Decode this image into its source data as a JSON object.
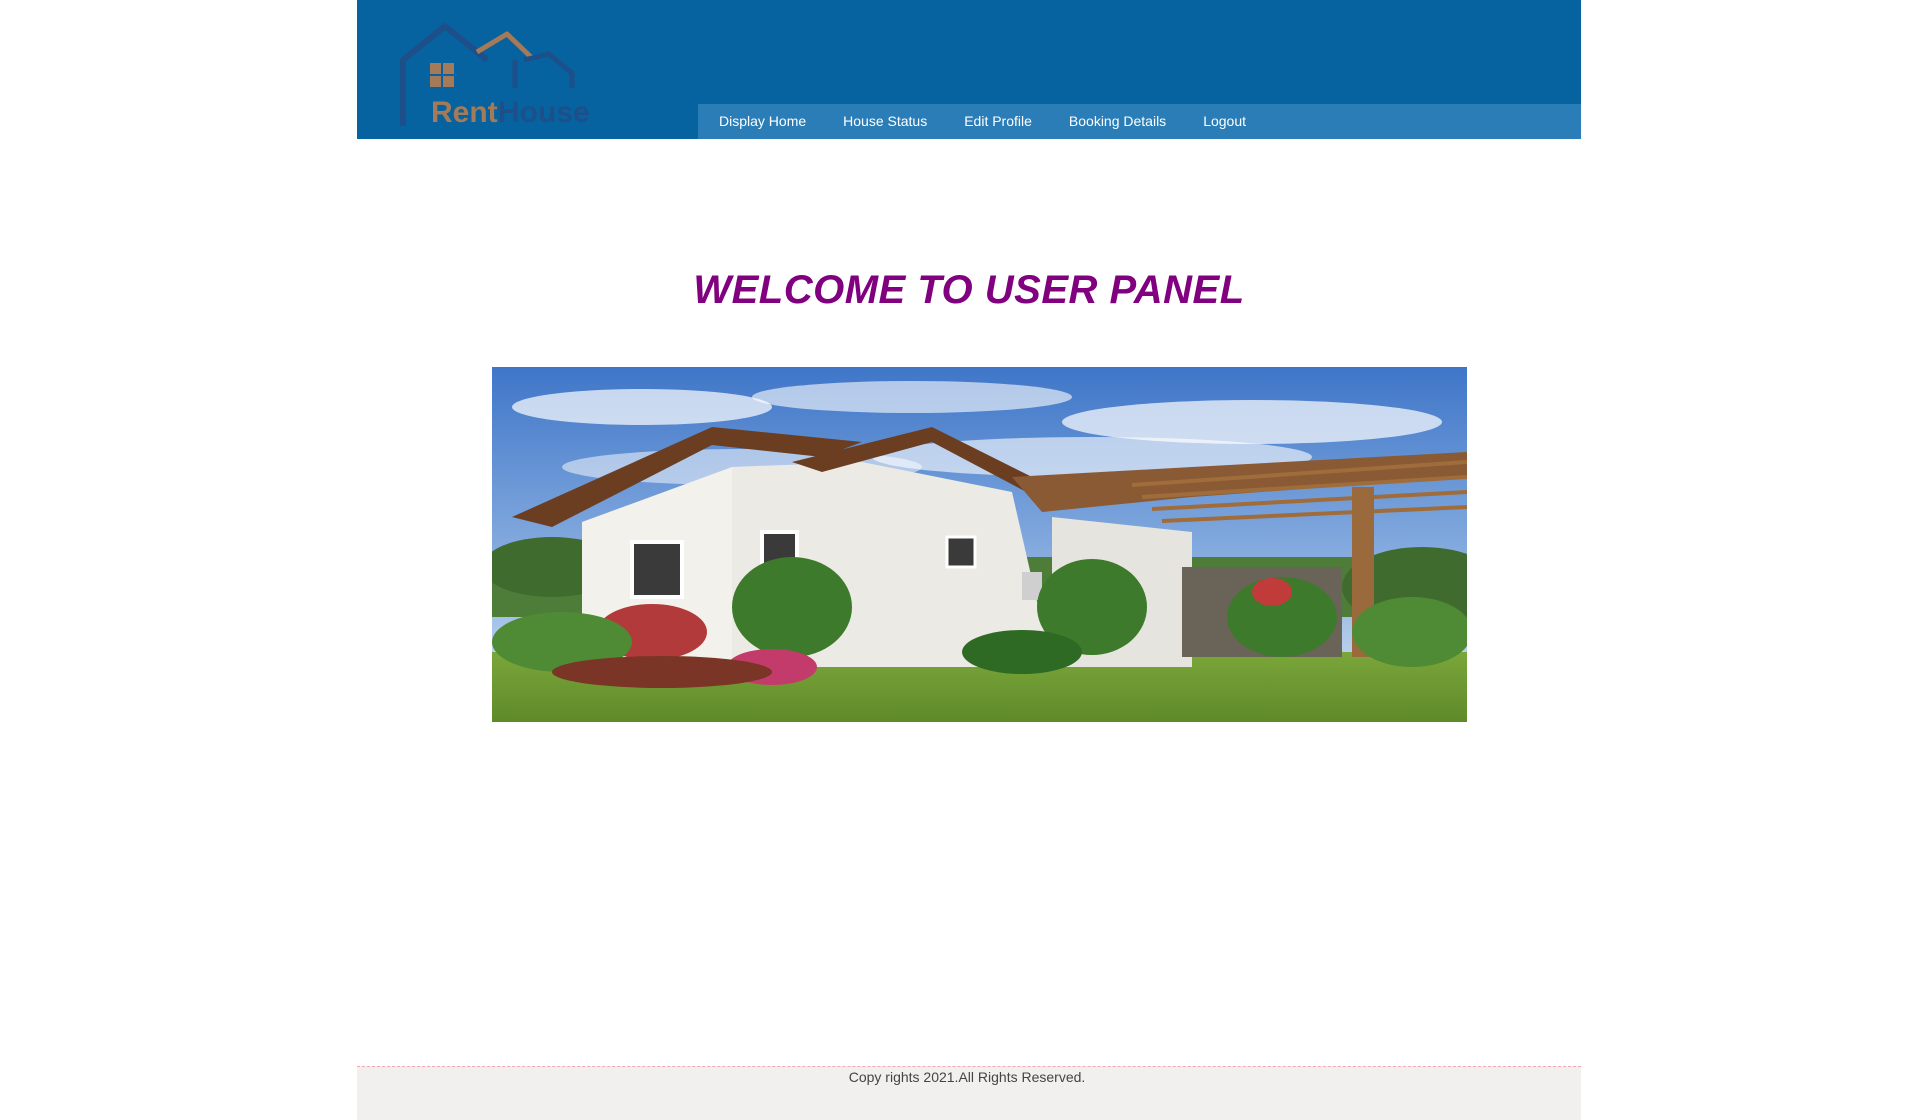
{
  "brand": {
    "logo_text_part1": "Rent",
    "logo_text_part2": "House",
    "logo_colors": {
      "house_blue": "#1d4f8a",
      "house_brown": "#a47a58",
      "window": "#a47a58"
    }
  },
  "colors": {
    "header_bg": "#06639f",
    "nav_bg": "#2a7db6",
    "welcome_text": "#800080",
    "footer_bg": "#f1f0ef"
  },
  "nav": {
    "items": [
      {
        "label": "Display Home"
      },
      {
        "label": "House Status"
      },
      {
        "label": "Edit Profile"
      },
      {
        "label": "Booking Details"
      },
      {
        "label": "Logout"
      }
    ]
  },
  "main": {
    "welcome_title": "WELCOME TO USER PANEL",
    "hero_image": "house-photo"
  },
  "footer": {
    "copyright": "Copy rights 2021.All Rights Reserved."
  }
}
